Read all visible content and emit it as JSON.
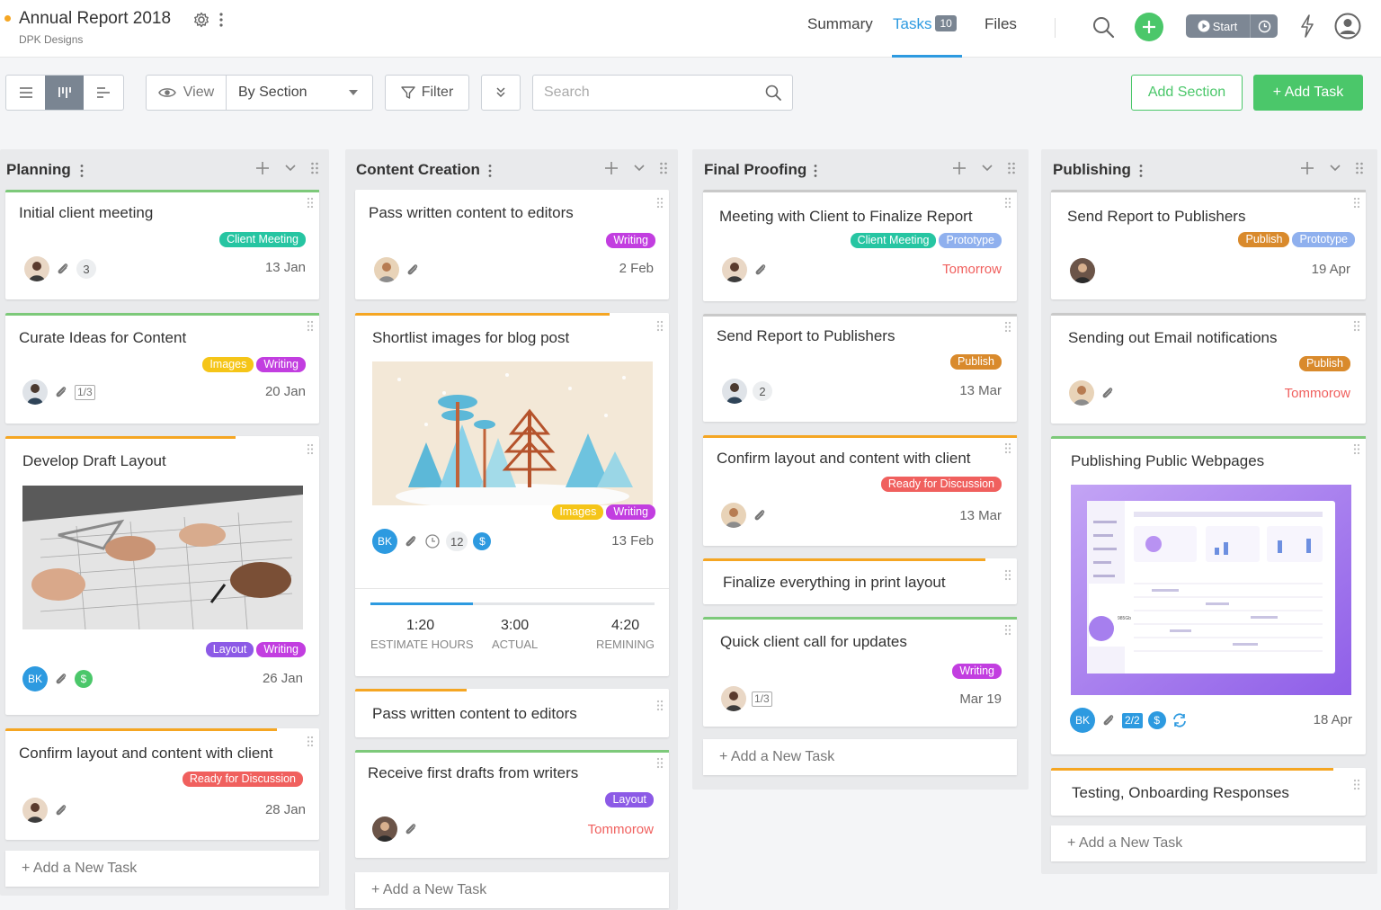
{
  "project": {
    "title": "Annual Report 2018",
    "subtitle": "DPK Designs",
    "accent": "#f5a623"
  },
  "nav": {
    "tabs": [
      {
        "label": "Summary"
      },
      {
        "label": "Tasks",
        "badge": "10",
        "active": true
      },
      {
        "label": "Files"
      }
    ],
    "timer_label": "Start"
  },
  "toolbar": {
    "view_label": "View",
    "group_by": "By Section",
    "filter_label": "Filter",
    "search_placeholder": "Search",
    "add_section": "Add Section",
    "add_task": "+ Add Task"
  },
  "columns": [
    {
      "title": "Planning",
      "add_new": "+ Add a New Task",
      "cards": [
        {
          "title": "Initial client meeting",
          "tags": [
            "Client Meeting"
          ],
          "count": "3",
          "date": "13 Jan"
        },
        {
          "title": "Curate Ideas for Content",
          "tags": [
            "Images",
            "Writing"
          ],
          "subtasks": "1/3",
          "date": "20 Jan"
        },
        {
          "title": "Develop Draft Layout",
          "tags": [
            "Layout",
            "Writing"
          ],
          "avatar_initials": "BK",
          "date": "26 Jan"
        },
        {
          "title": "Confirm layout and content with client",
          "tags": [
            "Ready for Discussion"
          ],
          "date": "28 Jan"
        }
      ]
    },
    {
      "title": "Content Creation",
      "add_new": "+ Add a New Task",
      "cards": [
        {
          "title": "Pass written content to editors",
          "tags": [
            "Writing"
          ],
          "date": "2 Feb"
        },
        {
          "title": "Shortlist images for blog post",
          "tags": [
            "Images",
            "Writing"
          ],
          "avatar_initials": "BK",
          "count": "12",
          "date": "13 Feb",
          "estimate": {
            "estimate_hours": "1:20",
            "estimate_label": "ESTIMATE HOURS",
            "actual": "3:00",
            "actual_label": "ACTUAL",
            "remaining": "4:20",
            "remaining_label": "REMINING",
            "progress": 0.36
          }
        },
        {
          "title": "Pass written content to editors"
        },
        {
          "title": "Receive first drafts from writers",
          "tags": [
            "Layout"
          ],
          "date": "Tommorow"
        }
      ]
    },
    {
      "title": "Final Proofing",
      "add_new": "+ Add a New Task",
      "cards": [
        {
          "title": "Meeting with Client to Finalize Report",
          "tags": [
            "Client Meeting",
            "Prototype"
          ],
          "date": "Tomorrow"
        },
        {
          "title": "Send Report to Publishers",
          "tags": [
            "Publish"
          ],
          "count": "2",
          "date": "13 Mar"
        },
        {
          "title": "Confirm layout and content with client",
          "tags": [
            "Ready for Discussion"
          ],
          "date": "13 Mar"
        },
        {
          "title": "Finalize everything in print layout"
        },
        {
          "title": "Quick client call for updates",
          "tags": [
            "Writing"
          ],
          "subtasks": "1/3",
          "date": "Mar 19"
        }
      ]
    },
    {
      "title": "Publishing",
      "add_new": "+ Add a New Task",
      "cards": [
        {
          "title": "Send Report to Publishers",
          "tags": [
            "Publish",
            "Prototype"
          ],
          "date": "19 Apr"
        },
        {
          "title": "Sending out Email notifications",
          "tags": [
            "Publish"
          ],
          "date": "Tommorow"
        },
        {
          "title": "Publishing Public Webpages",
          "avatar_initials": "BK",
          "subtasks": "2/2",
          "date": "18 Apr",
          "preview_stat": "985Gb"
        },
        {
          "title": "Testing, Onboarding Responses"
        }
      ]
    }
  ],
  "colors": {
    "green": "#4bc76a",
    "blue": "#2d9ae0",
    "orange": "#f5a623",
    "client_meeting": "#26c5a2",
    "writing": "#c23ee0",
    "images": "#f5c518",
    "layout": "#8c5ae6",
    "ready": "#f0605e",
    "prototype": "#8fb0ee",
    "publish": "#d98a2c"
  }
}
